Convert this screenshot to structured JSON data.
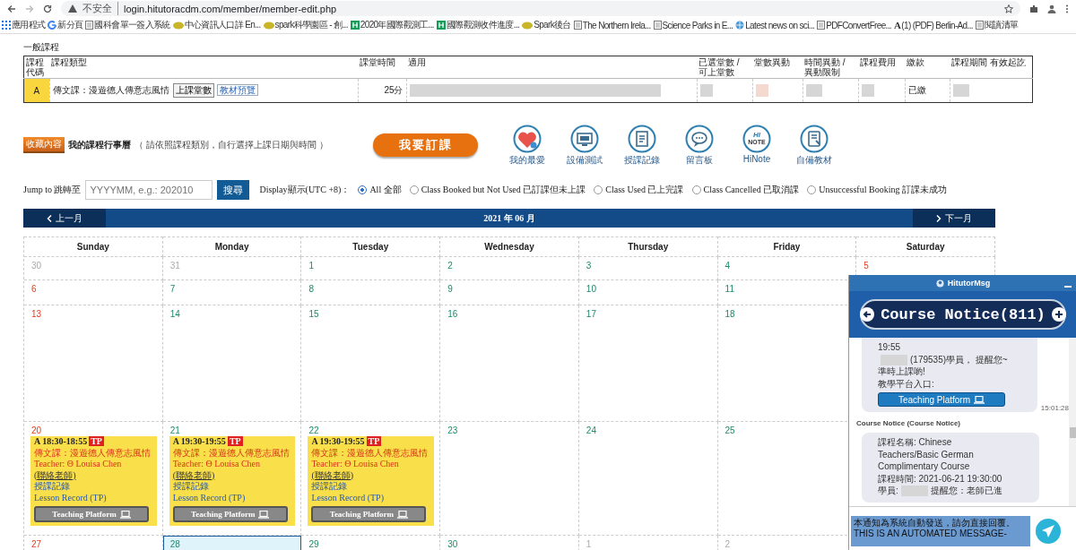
{
  "browser": {
    "security_label": "不安全",
    "url": "login.hitutoracdm.com/member/member-edit.php",
    "bookmarks": [
      {
        "label": "應用程式",
        "kind": "apps"
      },
      {
        "label": "新分頁",
        "kind": "google"
      },
      {
        "label": "國科會單一簽入系統",
        "kind": "page"
      },
      {
        "label": "中心資訊人口詳 En...",
        "kind": "folder"
      },
      {
        "label": "spark科學園區 - 創...",
        "kind": "folder"
      },
      {
        "label": "2020年國際觀測工...",
        "kind": "sheet"
      },
      {
        "label": "國際觀測收件進度...",
        "kind": "sheet"
      },
      {
        "label": "Spark後台",
        "kind": "folder"
      },
      {
        "label": "The Northern Irela...",
        "kind": "page"
      },
      {
        "label": "Science Parks in E...",
        "kind": "page"
      },
      {
        "label": "Latest news on sci...",
        "kind": "globe"
      },
      {
        "label": "PDFConvertFree...",
        "kind": "page"
      },
      {
        "label": "(1) (PDF) Berlin-Ad...",
        "kind": "letter",
        "icon_text": "A"
      },
      {
        "label": "閱讀清單",
        "kind": "page"
      }
    ]
  },
  "course_section": {
    "title": "一般課程",
    "columns": [
      "課程代碼",
      "課程類型",
      "課堂時間",
      "適用",
      "已選堂數 / 可上堂數",
      "堂數異動",
      "時間異動 / 異動限制",
      "課程費用",
      "繳款",
      "課程期間 有效起訖"
    ],
    "rows": [
      {
        "code": "A",
        "type": "傳文課：漫遊德人傳意志風情",
        "buttons": [
          "上課堂數"
        ],
        "link": "教材預覽",
        "duration": "25分",
        "payment": "已繳"
      }
    ]
  },
  "schedule": {
    "badge": "收藏內容",
    "title": "我的課程行事曆",
    "hint": "（ 請依照課程類別，自行選擇上課日期與時間 ）",
    "book_button": "我要訂課",
    "tools": [
      {
        "label": "我的最愛",
        "kind": "heart"
      },
      {
        "label": "設備測試",
        "kind": "monitor"
      },
      {
        "label": "授課記錄",
        "kind": "document"
      },
      {
        "label": "留言板",
        "kind": "chat"
      },
      {
        "label": "HiNote",
        "kind": "note",
        "icon_lines": [
          "HI",
          "NOTE"
        ]
      },
      {
        "label": "自備教材",
        "kind": "book"
      }
    ]
  },
  "filter": {
    "jump_label": "Jump to 跳轉至",
    "placeholder": "YYYYMM, e.g.: 202010",
    "search_button": "搜尋",
    "display_label": "Display顯示(UTC +8)：",
    "options": [
      {
        "label": "All 全部",
        "selected": true
      },
      {
        "label": "Class Booked but Not Used 已訂課但未上課",
        "selected": false
      },
      {
        "label": "Class Used 已上完課",
        "selected": false
      },
      {
        "label": "Class Cancelled 已取消課",
        "selected": false
      },
      {
        "label": "Unsuccessful Booking 訂課未成功",
        "selected": false
      }
    ]
  },
  "calendar": {
    "prev": "上一月",
    "title": "2021 年 06 月",
    "next": "下一月",
    "weekdays": [
      "Sunday",
      "Monday",
      "Tuesday",
      "Wednesday",
      "Thursday",
      "Friday",
      "Saturday"
    ],
    "weeks": [
      [
        {
          "day": "30",
          "kind": "outside",
          "selected": false
        },
        {
          "day": "31",
          "kind": "outside",
          "selected": false
        },
        {
          "day": "1",
          "kind": "weekday",
          "selected": false
        },
        {
          "day": "2",
          "kind": "weekday",
          "selected": false
        },
        {
          "day": "3",
          "kind": "weekday",
          "selected": false
        },
        {
          "day": "4",
          "kind": "weekday",
          "selected": false
        },
        {
          "day": "5",
          "kind": "weekend",
          "selected": false
        }
      ],
      [
        {
          "day": "6",
          "kind": "weekend",
          "selected": false
        },
        {
          "day": "7",
          "kind": "weekday",
          "selected": false
        },
        {
          "day": "8",
          "kind": "weekday",
          "selected": false
        },
        {
          "day": "9",
          "kind": "weekday",
          "selected": false
        },
        {
          "day": "10",
          "kind": "weekday",
          "selected": false
        },
        {
          "day": "11",
          "kind": "weekday",
          "selected": false
        }
      ],
      [
        {
          "day": "13",
          "kind": "weekend",
          "selected": false
        },
        {
          "day": "14",
          "kind": "weekday",
          "selected": false
        },
        {
          "day": "15",
          "kind": "weekday",
          "selected": false
        },
        {
          "day": "16",
          "kind": "weekday",
          "selected": false
        },
        {
          "day": "17",
          "kind": "weekday",
          "selected": false
        },
        {
          "day": "18",
          "kind": "weekday",
          "selected": false
        }
      ],
      [
        {
          "day": "20",
          "kind": "weekend",
          "selected": false,
          "events": [
            {
              "time": "A 18:30-18:55",
              "badge": "TP",
              "course": "傳文課：漫遊德人傳意志風情",
              "teacher": "Teacher: Θ Louisa Chen",
              "contact": "(聯絡老師)",
              "record": "授課記錄",
              "lesson_record": "Lesson Record (TP)",
              "button": "Teaching Platform"
            }
          ]
        },
        {
          "day": "21",
          "kind": "weekday",
          "selected": false,
          "events": [
            {
              "time": "A 19:30-19:55",
              "badge": "TP",
              "course": "傳文課：漫遊德人傳意志風情",
              "teacher": "Teacher: Θ Louisa Chen",
              "contact": "(聯絡老師)",
              "record": "授課記錄",
              "lesson_record": "Lesson Record (TP)",
              "button": "Teaching Platform"
            }
          ]
        },
        {
          "day": "22",
          "kind": "weekday",
          "selected": false,
          "events": [
            {
              "time": "A 19:30-19:55",
              "badge": "TP",
              "course": "傳文課：漫遊德人傳意志風情",
              "teacher": "Teacher: Θ Louisa Chen",
              "contact": "(聯絡老師)",
              "record": "授課記錄",
              "lesson_record": "Lesson Record (TP)",
              "button": "Teaching Platform"
            }
          ]
        },
        {
          "day": "23",
          "kind": "weekday",
          "selected": false
        },
        {
          "day": "24",
          "kind": "weekday",
          "selected": false
        },
        {
          "day": "25",
          "kind": "weekday",
          "selected": false
        }
      ],
      [
        {
          "day": "27",
          "kind": "weekend",
          "selected": false
        },
        {
          "day": "28",
          "kind": "weekday",
          "selected": true
        },
        {
          "day": "29",
          "kind": "weekday",
          "selected": false
        },
        {
          "day": "30",
          "kind": "weekday",
          "selected": false
        },
        {
          "day": "1",
          "kind": "outside",
          "selected": false
        },
        {
          "day": "2",
          "kind": "outside",
          "selected": false
        }
      ]
    ]
  },
  "chat": {
    "title": "HitutorMsg",
    "banner": "Course Notice(811)",
    "messages": [
      {
        "lines": [
          [
            {
              "kind": "text",
              "text": "19:55"
            }
          ],
          [
            {
              "kind": "redacted"
            },
            {
              "kind": "text",
              "text": "(179535)學員， 提醒您~"
            }
          ],
          [
            {
              "kind": "text",
              "text": "準時上課喲!"
            }
          ],
          [
            {
              "kind": "text",
              "text": "教學平台入口:"
            }
          ]
        ],
        "button": "Teaching Platform",
        "time": "15:01:28"
      },
      {
        "sender": "Course Notice (Course Notice)",
        "lines": [
          [
            {
              "kind": "text",
              "text": "課程名稱: Chinese"
            }
          ],
          [
            {
              "kind": "text",
              "text": "Teachers/Basic German"
            }
          ],
          [
            {
              "kind": "text",
              "text": "Complimentary Course"
            }
          ],
          [
            {
              "kind": "text",
              "text": "課程時間: 2021-06-21 19:30:00"
            }
          ],
          [
            {
              "kind": "text",
              "text": "學員:"
            },
            {
              "kind": "redacted"
            },
            {
              "kind": "text",
              "text": "提醒您：老師已進"
            }
          ]
        ]
      }
    ],
    "input_value": "本通知為系統自動發送，請勿直接回覆。THIS IS AN AUTOMATED MESSAGE-"
  }
}
